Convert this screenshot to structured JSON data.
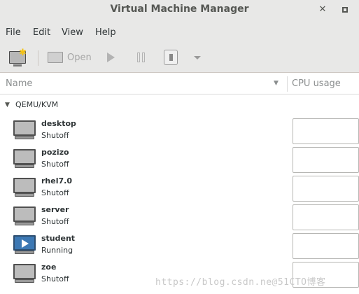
{
  "window": {
    "title": "Virtual Machine Manager"
  },
  "menu": [
    "File",
    "Edit",
    "View",
    "Help"
  ],
  "toolbar": {
    "open_label": "Open"
  },
  "columns": {
    "name": "Name",
    "cpu": "CPU usage"
  },
  "group": {
    "label": "QEMU/KVM"
  },
  "vms": [
    {
      "name": "desktop",
      "status": "Shutoff"
    },
    {
      "name": "pozizo",
      "status": "Shutoff"
    },
    {
      "name": "rhel7.0",
      "status": "Shutoff"
    },
    {
      "name": "server",
      "status": "Shutoff"
    },
    {
      "name": "student",
      "status": "Running"
    },
    {
      "name": "zoe",
      "status": "Shutoff"
    }
  ],
  "watermark": "https://blog.csdn.ne@51CTO博客"
}
